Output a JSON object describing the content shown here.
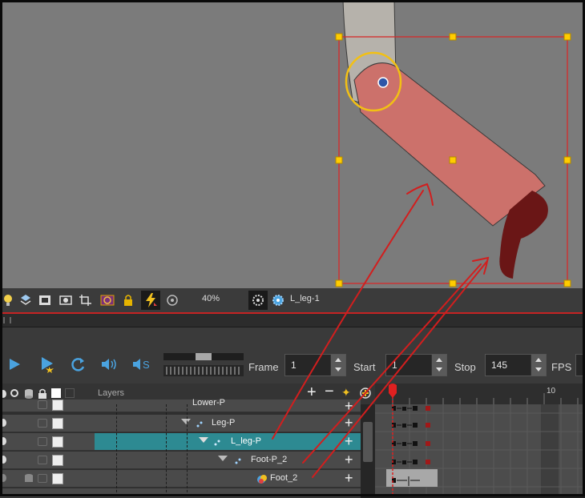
{
  "toolbar": {
    "icons": [
      "lightbulb-icon",
      "stack-up-icon",
      "rect-mask-icon",
      "camera-icon",
      "crop-icon",
      "onion-skin-icon",
      "lock-icon",
      "auto-key-icon",
      "pivot-icon"
    ],
    "zoom": "40%",
    "node_icons": [
      "peg-node-icon",
      "drawing-node-icon"
    ],
    "node_name": "L_leg-1"
  },
  "playback": {
    "frame_label": "Frame",
    "frame_value": "1",
    "start_label": "Start",
    "start_value": "1",
    "stop_label": "Stop",
    "stop_value": "145",
    "fps_label": "FPS"
  },
  "layers_panel": {
    "header_label": "Layers",
    "rows": [
      {
        "name": "Lower-P",
        "selected": false
      },
      {
        "name": "Leg-P",
        "selected": false
      },
      {
        "name": "L_leg-P",
        "selected": true
      },
      {
        "name": "Foot-P_2",
        "selected": false
      },
      {
        "name": "Foot_2",
        "selected": false
      }
    ]
  },
  "timeline": {
    "ruler_label": "10"
  },
  "colors": {
    "accent_red": "#d21e1e",
    "selection_teal": "#2d8a92",
    "leg_fill": "#cc716b",
    "foot_fill": "#6a1616",
    "pivot_ring": "#f2c014"
  }
}
